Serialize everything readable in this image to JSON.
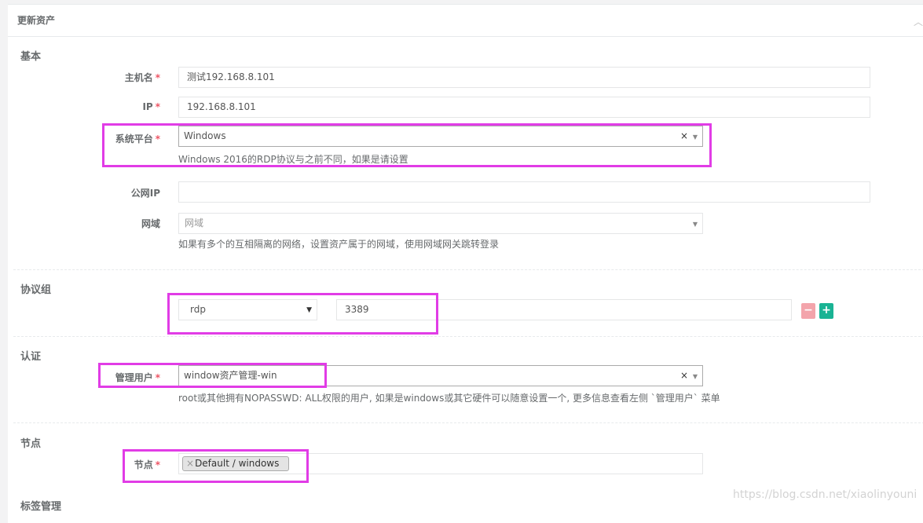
{
  "panel": {
    "title": "更新资产"
  },
  "sections": {
    "basic": "基本",
    "protocols": "协议组",
    "auth": "认证",
    "nodes": "节点",
    "labels": "标签管理"
  },
  "fields": {
    "hostname": {
      "label": "主机名",
      "value": "测试192.168.8.101"
    },
    "ip": {
      "label": "IP",
      "value": "192.168.8.101"
    },
    "platform": {
      "label": "系统平台",
      "value": "Windows",
      "help": "Windows 2016的RDP协议与之前不同，如果是请设置"
    },
    "public_ip": {
      "label": "公网IP",
      "value": ""
    },
    "domain": {
      "label": "网域",
      "placeholder": "网域",
      "help": "如果有多个的互相隔离的网络，设置资产属于的网域，使用网域网关跳转登录"
    },
    "protocol": {
      "name": "rdp",
      "port": "3389"
    },
    "admin_user": {
      "label": "管理用户",
      "value": "window资产管理-win",
      "help": "root或其他拥有NOPASSWD: ALL权限的用户, 如果是windows或其它硬件可以随意设置一个, 更多信息查看左侧 `管理用户` 菜单"
    },
    "nodes": {
      "label": "节点",
      "tags": [
        "Default / windows"
      ]
    }
  },
  "required_mark": "*",
  "clear_glyph": "×",
  "caret_glyph": "▼",
  "minus_glyph": "−",
  "plus_glyph": "+",
  "collapse_glyph": "︿",
  "watermark": "https://blog.csdn.net/xiaolinyouni",
  "colors": {
    "highlight": "#e13ce6",
    "required": "#ed5565",
    "remove_button": "#f3a4ab",
    "add_button": "#1ab394"
  }
}
